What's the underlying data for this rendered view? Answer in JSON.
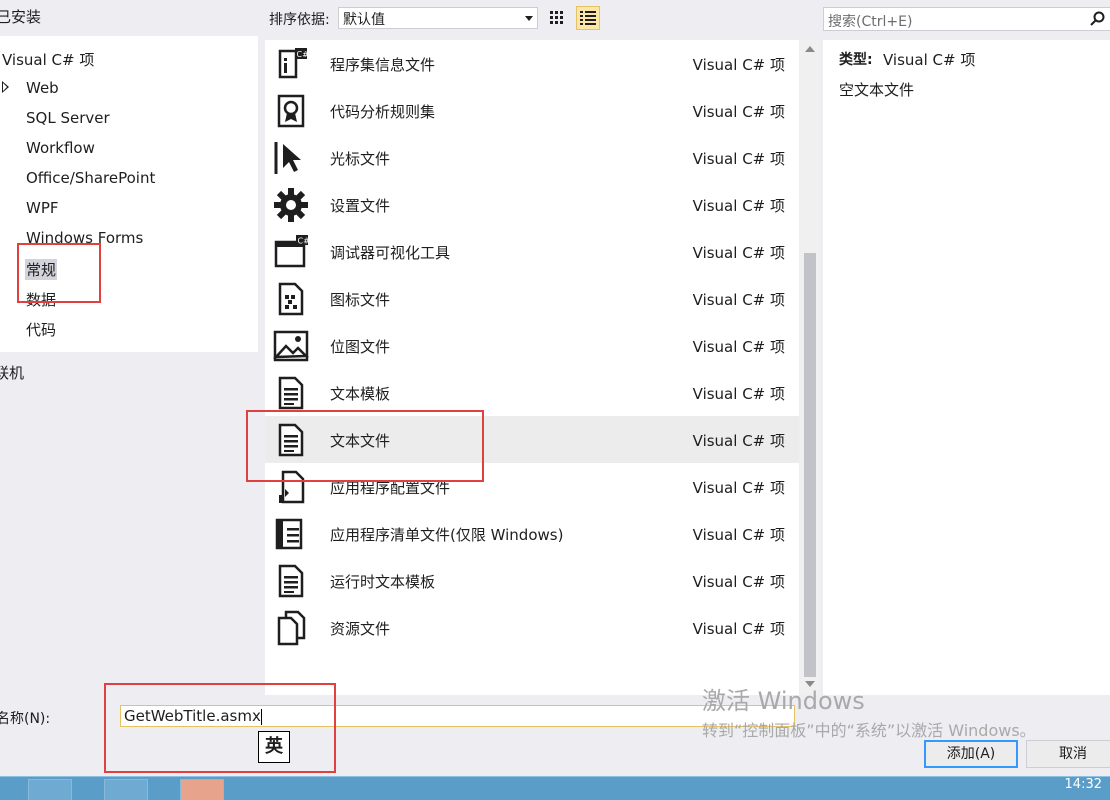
{
  "header": {
    "installed_label": "已安装",
    "sort_label": "排序依据:",
    "sort_value": "默认值",
    "search_placeholder": "搜索(Ctrl+E)"
  },
  "tree": {
    "root": "Visual C# 项",
    "items": [
      "Web",
      "SQL Server",
      "Workflow",
      "Office/SharePoint",
      "WPF",
      "Windows Forms",
      "常规",
      "数据",
      "代码"
    ],
    "selected": "常规",
    "online": "联机"
  },
  "templates": [
    {
      "name": "程序集信息文件",
      "type": "Visual C# 项",
      "icon": "assembly-info-icon"
    },
    {
      "name": "代码分析规则集",
      "type": "Visual C# 项",
      "icon": "ruleset-icon"
    },
    {
      "name": "光标文件",
      "type": "Visual C# 项",
      "icon": "cursor-icon"
    },
    {
      "name": "设置文件",
      "type": "Visual C# 项",
      "icon": "gear-icon"
    },
    {
      "name": "调试器可视化工具",
      "type": "Visual C# 项",
      "icon": "visualizer-icon"
    },
    {
      "name": "图标文件",
      "type": "Visual C# 项",
      "icon": "icon-file-icon"
    },
    {
      "name": "位图文件",
      "type": "Visual C# 项",
      "icon": "bitmap-icon"
    },
    {
      "name": "文本模板",
      "type": "Visual C# 项",
      "icon": "text-template-icon"
    },
    {
      "name": "文本文件",
      "type": "Visual C# 项",
      "icon": "text-file-icon",
      "selected": true
    },
    {
      "name": "应用程序配置文件",
      "type": "Visual C# 项",
      "icon": "config-file-icon"
    },
    {
      "name": "应用程序清单文件(仅限 Windows)",
      "type": "Visual C# 项",
      "icon": "manifest-icon"
    },
    {
      "name": "运行时文本模板",
      "type": "Visual C# 项",
      "icon": "runtime-template-icon"
    },
    {
      "name": "资源文件",
      "type": "Visual C# 项",
      "icon": "resource-file-icon"
    }
  ],
  "details": {
    "type_label": "类型:",
    "type_value": "Visual C# 项",
    "description": "空文本文件"
  },
  "footer": {
    "name_label": "名称(N):",
    "name_value": "GetWebTitle.asmx",
    "ime_indicator": "英",
    "add_button": "添加(A)",
    "cancel_button": "取消",
    "watermark_title": "激活 Windows",
    "watermark_text": "转到“控制面板”中的“系统”以激活 Windows。"
  },
  "taskbar": {
    "clock": "14:32"
  }
}
